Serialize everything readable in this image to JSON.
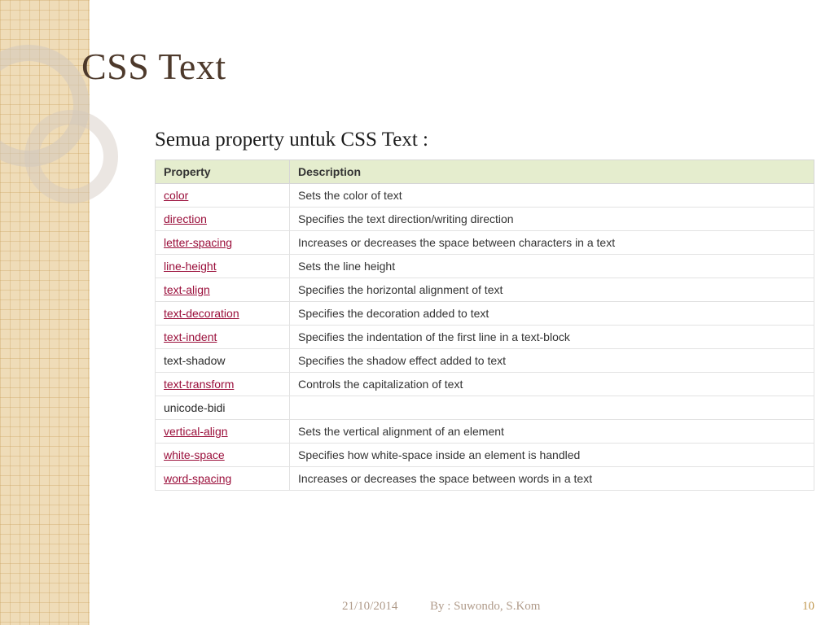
{
  "title": "CSS Text",
  "subtitle": "Semua property untuk CSS Text :",
  "footer": {
    "date": "21/10/2014",
    "author": "By : Suwondo, S.Kom",
    "page": "10"
  },
  "table": {
    "headers": [
      "Property",
      "Description"
    ],
    "rows": [
      {
        "prop": "color",
        "link": true,
        "desc": "Sets the color of text"
      },
      {
        "prop": "direction",
        "link": true,
        "desc": "Specifies the text direction/writing direction"
      },
      {
        "prop": "letter-spacing",
        "link": true,
        "desc": "Increases or decreases the space between characters in a text"
      },
      {
        "prop": "line-height",
        "link": true,
        "desc": "Sets the line height"
      },
      {
        "prop": "text-align",
        "link": true,
        "desc": "Specifies the horizontal alignment of text"
      },
      {
        "prop": "text-decoration",
        "link": true,
        "desc": "Specifies the decoration added to text"
      },
      {
        "prop": "text-indent",
        "link": true,
        "desc": "Specifies the indentation of the first line in a text-block"
      },
      {
        "prop": "text-shadow",
        "link": false,
        "desc": "Specifies the shadow effect added to text"
      },
      {
        "prop": "text-transform",
        "link": true,
        "desc": "Controls the capitalization of text"
      },
      {
        "prop": "unicode-bidi",
        "link": false,
        "desc": ""
      },
      {
        "prop": "vertical-align",
        "link": true,
        "desc": "Sets the vertical alignment of an element"
      },
      {
        "prop": "white-space",
        "link": true,
        "desc": "Specifies how white-space inside an element is handled"
      },
      {
        "prop": "word-spacing",
        "link": true,
        "desc": "Increases or decreases the space between words in a text"
      }
    ]
  }
}
